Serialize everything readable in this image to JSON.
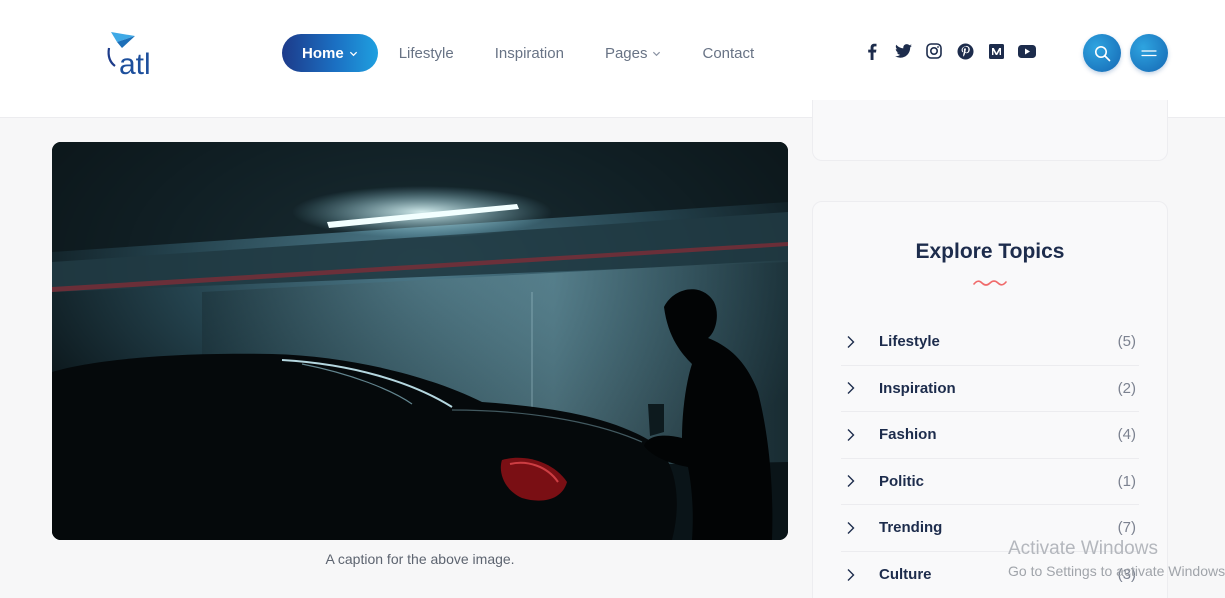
{
  "brand": {
    "logo_text": "atl"
  },
  "nav": {
    "items": [
      {
        "label": "Home",
        "active": true,
        "dropdown": true
      },
      {
        "label": "Lifestyle",
        "active": false,
        "dropdown": false
      },
      {
        "label": "Inspiration",
        "active": false,
        "dropdown": false
      },
      {
        "label": "Pages",
        "active": false,
        "dropdown": true
      },
      {
        "label": "Contact",
        "active": false,
        "dropdown": false
      }
    ]
  },
  "social": {
    "icons": [
      "facebook-icon",
      "twitter-icon",
      "instagram-icon",
      "pinterest-icon",
      "medium-icon",
      "youtube-icon"
    ]
  },
  "header_buttons": {
    "search_icon": "search-icon",
    "menu_icon": "menu-icon"
  },
  "article": {
    "caption": "A caption for the above image."
  },
  "sidebar": {
    "explore": {
      "title": "Explore Topics",
      "topics": [
        {
          "label": "Lifestyle",
          "count": "(5)"
        },
        {
          "label": "Inspiration",
          "count": "(2)"
        },
        {
          "label": "Fashion",
          "count": "(4)"
        },
        {
          "label": "Politic",
          "count": "(1)"
        },
        {
          "label": "Trending",
          "count": "(7)"
        },
        {
          "label": "Culture",
          "count": "(3)"
        }
      ]
    }
  },
  "watermark": {
    "line1": "Activate Windows",
    "line2": "Go to Settings to activate Windows."
  },
  "colors": {
    "accent_gradient_start": "#1d3b8a",
    "accent_gradient_end": "#1fa0e0",
    "heading": "#1d2c4c",
    "squiggle": "#f06a6a"
  }
}
